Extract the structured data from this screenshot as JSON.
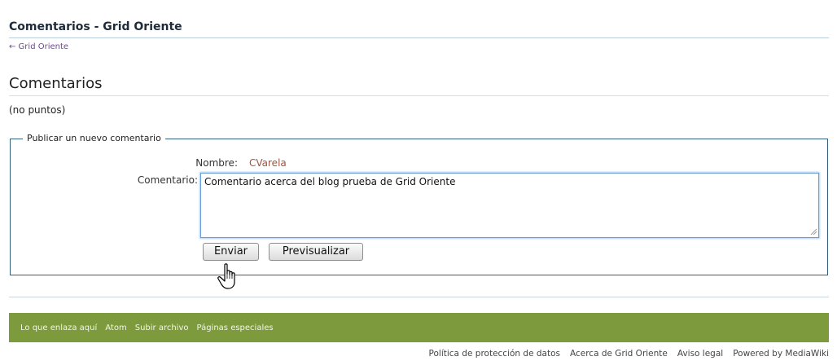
{
  "page": {
    "title": "Comentarios - Grid Oriente",
    "back_link": "← Grid Oriente",
    "section_heading": "Comentarios",
    "no_points": "(no puntos)"
  },
  "form": {
    "legend": "Publicar un nuevo comentario",
    "name_label": "Nombre:",
    "name_value": "CVarela",
    "comment_label": "Comentario:",
    "comment_value": "Comentario acerca del blog prueba de Grid Oriente",
    "send_button": "Enviar",
    "preview_button": "Previsualizar"
  },
  "footer": {
    "links": [
      "Lo que enlaza aquí",
      "Atom",
      "Subir archivo",
      "Páginas especiales"
    ],
    "bottom_links": [
      "Política de protección de datos",
      "Acerca de Grid Oriente",
      "Aviso legal",
      "Powered by MediaWiki"
    ]
  },
  "colors": {
    "footer_bar": "#7d9b3c",
    "link_purple": "#6a4a8c",
    "name_value": "#a0523c",
    "fieldset_border": "#34607f"
  },
  "icons": {
    "cursor": "hand-pointer-icon",
    "resize": "resize-grip-icon"
  }
}
